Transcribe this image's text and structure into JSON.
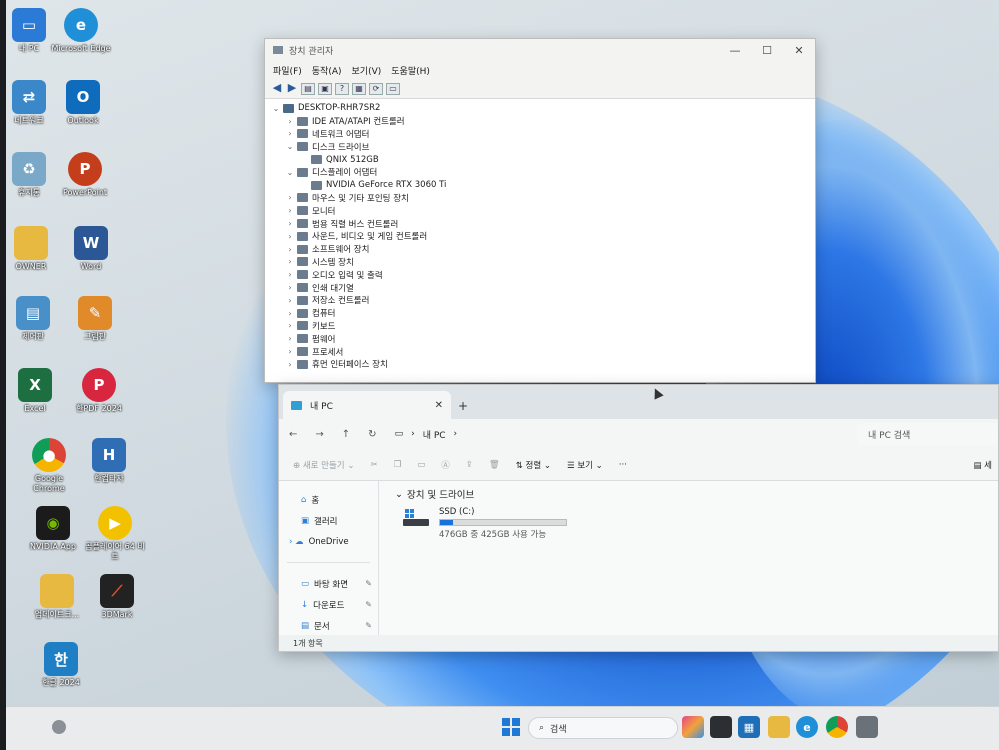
{
  "desktop": {
    "icons": [
      {
        "label": "내 PC",
        "icon": "monitor-icon",
        "color": "#2b7bd6"
      },
      {
        "label": "Microsoft Edge",
        "icon": "edge-icon",
        "color": "#1f8fd8"
      },
      {
        "label": "네트워크",
        "icon": "network-icon",
        "color": "#3a88c9"
      },
      {
        "label": "Outlook",
        "icon": "outlook-icon",
        "color": "#0f6cbd"
      },
      {
        "label": "휴지통",
        "icon": "recycle-bin-icon",
        "color": "#7aa8c8"
      },
      {
        "label": "PowerPoint",
        "icon": "powerpoint-icon",
        "color": "#c43e1c"
      },
      {
        "label": "OWNER",
        "icon": "folder-icon",
        "color": "#e8b940"
      },
      {
        "label": "Word",
        "icon": "word-icon",
        "color": "#2b5797"
      },
      {
        "label": "제어판",
        "icon": "control-panel-icon",
        "color": "#4a90c8"
      },
      {
        "label": "그림판",
        "icon": "paint-icon",
        "color": "#e08a2a"
      },
      {
        "label": "Excel",
        "icon": "excel-icon",
        "color": "#1d6f42"
      },
      {
        "label": "한PDF 2024",
        "icon": "hanpdf-icon",
        "color": "#d7263d"
      },
      {
        "label": "Google Chrome",
        "icon": "chrome-icon",
        "color": "#4285f4"
      },
      {
        "label": "한컴타자",
        "icon": "hancom-typing-icon",
        "color": "#2f6db5"
      },
      {
        "label": "NVIDIA App",
        "icon": "nvidia-icon",
        "color": "#76b900"
      },
      {
        "label": "곰플레이어 64 비트",
        "icon": "gomplayer-icon",
        "color": "#f2c200"
      },
      {
        "label": "업데이트크...",
        "icon": "folder-icon",
        "color": "#e8b940"
      },
      {
        "label": "3DMark",
        "icon": "3dmark-icon",
        "color": "#e0562a"
      },
      {
        "label": "한글 2024",
        "icon": "hwp-icon",
        "color": "#1f7fc4"
      }
    ],
    "accent": "#1f63d6"
  },
  "device_manager": {
    "title": "장치 관리자",
    "menu": [
      "파일(F)",
      "동작(A)",
      "보기(V)",
      "도움말(H)"
    ],
    "root": "DESKTOP-RHR7SR2",
    "tree": [
      {
        "label": "IDE ATA/ATAPI 컨트롤러",
        "expanded": false,
        "children": []
      },
      {
        "label": "네트워크 어댑터",
        "expanded": false,
        "children": []
      },
      {
        "label": "디스크 드라이브",
        "expanded": true,
        "children": [
          "QNIX 512GB"
        ]
      },
      {
        "label": "디스플레이 어댑터",
        "expanded": true,
        "children": [
          "NVIDIA GeForce RTX 3060 Ti"
        ]
      },
      {
        "label": "마우스 및 기타 포인팅 장치",
        "expanded": false,
        "children": []
      },
      {
        "label": "모니터",
        "expanded": false,
        "children": []
      },
      {
        "label": "범용 직렬 버스 컨트롤러",
        "expanded": false,
        "children": []
      },
      {
        "label": "사운드, 비디오 및 게임 컨트롤러",
        "expanded": false,
        "children": []
      },
      {
        "label": "소프트웨어 장치",
        "expanded": false,
        "children": []
      },
      {
        "label": "시스템 장치",
        "expanded": false,
        "children": []
      },
      {
        "label": "오디오 입력 및 출력",
        "expanded": false,
        "children": []
      },
      {
        "label": "인쇄 대기열",
        "expanded": false,
        "children": []
      },
      {
        "label": "저장소 컨트롤러",
        "expanded": false,
        "children": []
      },
      {
        "label": "컴퓨터",
        "expanded": false,
        "children": []
      },
      {
        "label": "키보드",
        "expanded": false,
        "children": []
      },
      {
        "label": "펌웨어",
        "expanded": false,
        "children": []
      },
      {
        "label": "프로세서",
        "expanded": false,
        "children": []
      },
      {
        "label": "휴먼 인터페이스 장치",
        "expanded": false,
        "children": []
      }
    ]
  },
  "explorer": {
    "tab_label": "내 PC",
    "new_tab": "+",
    "path_label": "내 PC",
    "search_placeholder": "내 PC 검색",
    "commands": {
      "new": "새로 만들기",
      "sort": "정렬",
      "view": "보기",
      "more": "···"
    },
    "nav": [
      {
        "label": "홈",
        "icon": "home-icon",
        "pinned": false
      },
      {
        "label": "갤러리",
        "icon": "gallery-icon",
        "pinned": false
      },
      {
        "label": "OneDrive",
        "icon": "onedrive-icon",
        "pinned": false
      },
      {
        "label": "바탕 화면",
        "icon": "desktop-icon",
        "pinned": true
      },
      {
        "label": "다운로드",
        "icon": "download-icon",
        "pinned": true
      },
      {
        "label": "문서",
        "icon": "documents-icon",
        "pinned": true
      }
    ],
    "section_title": "장치 및 드라이브",
    "drive": {
      "name": "SSD (C:)",
      "detail": "476GB 중 425GB 사용 가능",
      "used_fraction": 0.107
    },
    "status": "1개 항목",
    "detail_button": "세"
  },
  "taskbar": {
    "search_label": "검색",
    "icons": [
      "start-icon",
      "search-icon",
      "copilot-icon",
      "task-view-icon",
      "store-icon",
      "file-explorer-icon",
      "edge-icon",
      "chrome-icon",
      "app-icon"
    ]
  }
}
